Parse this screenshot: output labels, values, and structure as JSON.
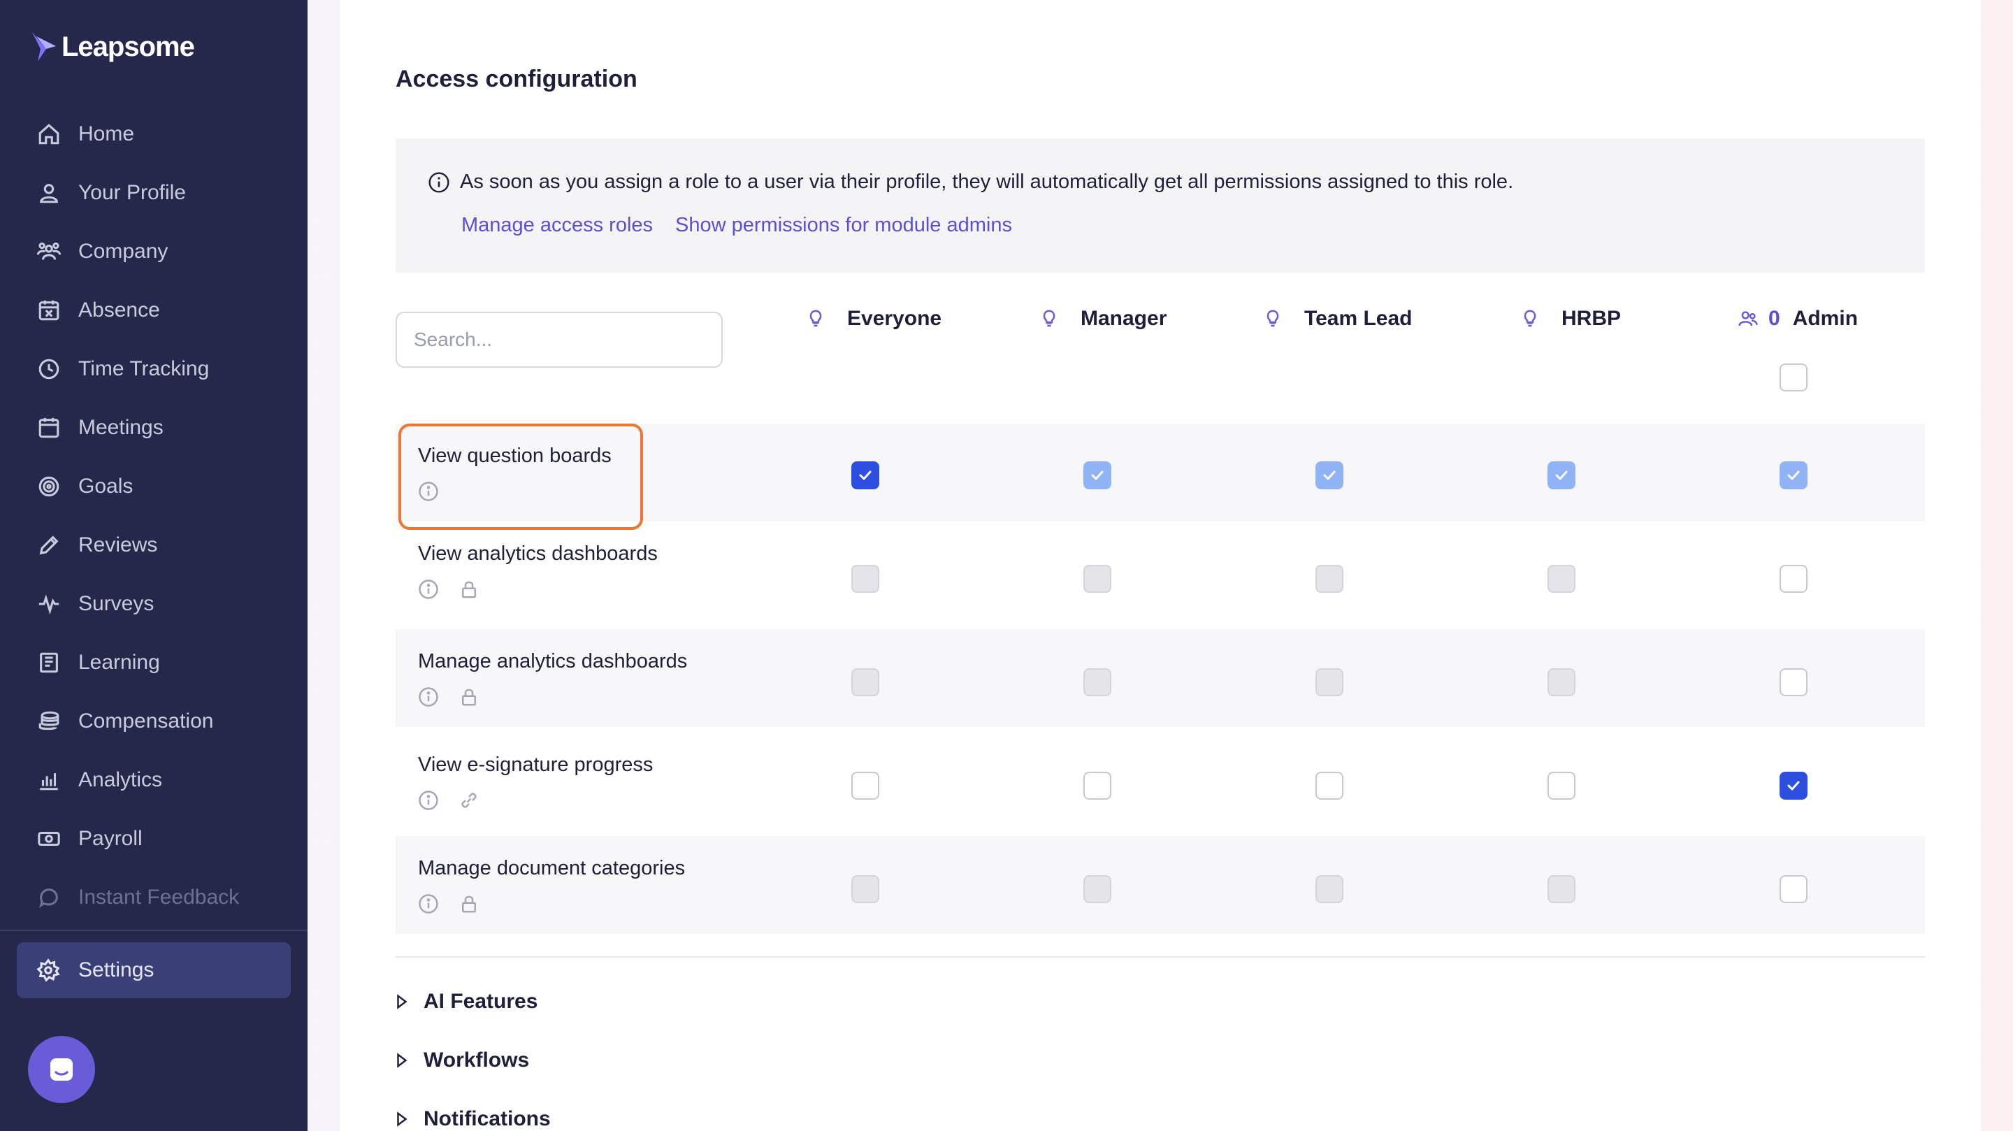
{
  "app": {
    "logo_text": "Leapsome"
  },
  "sidebar": {
    "items": [
      {
        "label": "Home",
        "icon": "home-icon"
      },
      {
        "label": "Your Profile",
        "icon": "user-icon"
      },
      {
        "label": "Company",
        "icon": "people-icon"
      },
      {
        "label": "Absence",
        "icon": "calendar-x-icon"
      },
      {
        "label": "Time Tracking",
        "icon": "clock-icon"
      },
      {
        "label": "Meetings",
        "icon": "calendar-icon"
      },
      {
        "label": "Goals",
        "icon": "target-icon"
      },
      {
        "label": "Reviews",
        "icon": "pencil-icon"
      },
      {
        "label": "Surveys",
        "icon": "pulse-icon"
      },
      {
        "label": "Learning",
        "icon": "book-icon"
      },
      {
        "label": "Compensation",
        "icon": "coins-icon"
      },
      {
        "label": "Analytics",
        "icon": "bar-chart-icon"
      },
      {
        "label": "Payroll",
        "icon": "cash-icon"
      },
      {
        "label": "Instant Feedback",
        "icon": "chat-icon"
      }
    ],
    "settings_label": "Settings"
  },
  "main": {
    "title": "Access configuration",
    "info_text": "As soon as you assign a role to a user via their profile, they will automatically get all permissions assigned to this role.",
    "link_manage_roles": "Manage access roles",
    "link_show_permissions": "Show permissions for module admins",
    "search_placeholder": "Search...",
    "columns": [
      {
        "label": "Everyone",
        "icon": "lightbulb-icon"
      },
      {
        "label": "Manager",
        "icon": "lightbulb-icon"
      },
      {
        "label": "Team Lead",
        "icon": "lightbulb-icon"
      },
      {
        "label": "HRBP",
        "icon": "lightbulb-icon"
      },
      {
        "label": "Admin",
        "icon": "users-icon",
        "count": "0"
      }
    ],
    "permissions": [
      {
        "label": "View question boards",
        "states": [
          "checked",
          "checked-light",
          "checked-light",
          "checked-light",
          "checked-light"
        ]
      },
      {
        "label": "View analytics dashboards",
        "states": [
          "disabled",
          "disabled",
          "disabled",
          "disabled",
          "unchecked"
        ]
      },
      {
        "label": "Manage analytics dashboards",
        "states": [
          "disabled",
          "disabled",
          "disabled",
          "disabled",
          "unchecked"
        ]
      },
      {
        "label": "View e-signature progress",
        "states": [
          "unchecked",
          "unchecked",
          "unchecked",
          "unchecked",
          "checked"
        ]
      },
      {
        "label": "Manage document categories",
        "states": [
          "disabled",
          "disabled",
          "disabled",
          "disabled",
          "unchecked"
        ]
      }
    ],
    "sections": [
      {
        "label": "AI Features"
      },
      {
        "label": "Workflows"
      },
      {
        "label": "Notifications"
      }
    ]
  },
  "colors": {
    "sidebar_bg": "#25284b",
    "accent": "#5b4fd6",
    "checkbox_checked": "#2d4fe0",
    "checkbox_inherited": "#8fb3f5",
    "highlight": "#f07534"
  }
}
